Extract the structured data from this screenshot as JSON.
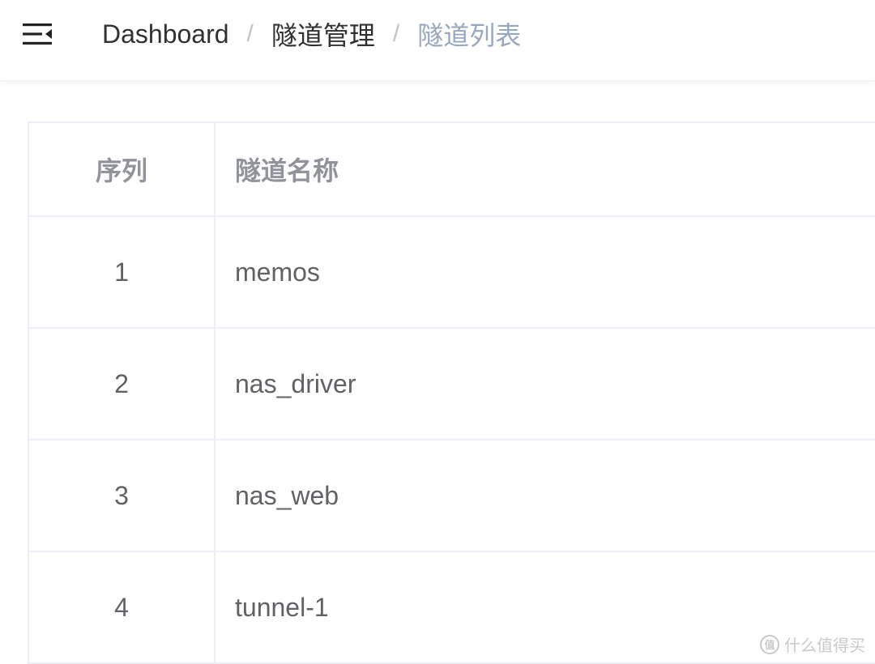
{
  "header": {
    "menu_icon": "hamburger-fold-icon",
    "breadcrumb": [
      {
        "label": "Dashboard"
      },
      {
        "label": "隧道管理"
      },
      {
        "label": "隧道列表"
      }
    ],
    "separator": "/"
  },
  "table": {
    "columns": [
      "序列",
      "隧道名称"
    ],
    "rows": [
      {
        "index": "1",
        "name": "memos"
      },
      {
        "index": "2",
        "name": "nas_driver"
      },
      {
        "index": "3",
        "name": "nas_web"
      },
      {
        "index": "4",
        "name": "tunnel-1"
      }
    ]
  },
  "watermark": {
    "logo": "值",
    "text": "什么值得买"
  },
  "colors": {
    "text_primary": "#303133",
    "text_regular": "#606266",
    "text_header": "#909399",
    "breadcrumb_last": "#97a8be",
    "border": "#ebeef5"
  }
}
